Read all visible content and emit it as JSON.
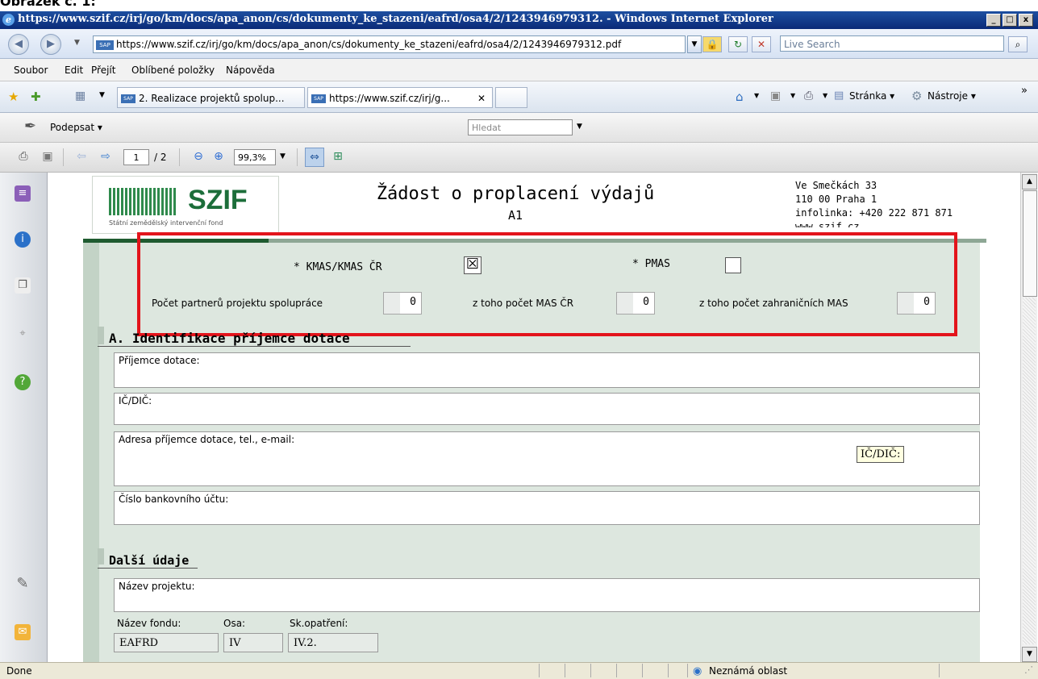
{
  "caption": "Obrázek č. 1:",
  "window": {
    "title": "https://www.szif.cz/irj/go/km/docs/apa_anon/cs/dokumenty_ke_stazeni/eafrd/osa4/2/1243946979312. - Windows Internet Explorer",
    "min": "_",
    "max": "□",
    "close": "x"
  },
  "address": {
    "url": "https://www.szif.cz/irj/go/km/docs/apa_anon/cs/dokumenty_ke_stazeni/eafrd/osa4/2/1243946979312.pdf",
    "search_placeholder": "Live Search"
  },
  "menu": [
    "Soubor",
    "Edit",
    "Přejít",
    "Oblíbené položky",
    "Nápověda"
  ],
  "tabs": [
    {
      "label": "2. Realizace projektů spolup..."
    },
    {
      "label": "https://www.szif.cz/irj/g..."
    }
  ],
  "commands": {
    "page": "Stránka",
    "tools": "Nástroje"
  },
  "pdf_toolbar1": {
    "sign": "Podepsat",
    "search_placeholder": "Hledat"
  },
  "pdf_toolbar2": {
    "page_current": "1",
    "page_total": "/ 2",
    "zoom": "99,3%"
  },
  "document": {
    "logo_text": "SZIF",
    "logo_sub": "Státní zemědělský intervenční fond",
    "title": "Žádost o proplacení výdajů",
    "subtitle": "A1",
    "address_lines": [
      "Ve Smečkách 33",
      "110 00 Praha 1",
      "infolinka: +420 222 871 871",
      "www.szif.cz"
    ],
    "kmas_label": "* KMAS/KMAS ČR",
    "kmas_checked": true,
    "pmas_label": "* PMAS",
    "pmas_checked": false,
    "partners_label": "Počet partnerů projektu spolupráce",
    "partners_value": "0",
    "mas_cr_label": "z toho počet MAS ČR",
    "mas_cr_value": "0",
    "mas_foreign_label": "z toho počet zahraničních MAS",
    "mas_foreign_value": "0",
    "section_a": "A. Identifikace příjemce dotace",
    "field_recipient": "Příjemce dotace:",
    "field_ico": "IČ/DIČ:",
    "field_address": "Adresa příjemce dotace, tel., e-mail:",
    "field_account": "Číslo bankovního účtu:",
    "tooltip": "IČ/DIČ:",
    "section_other": "Další údaje",
    "field_project": "Název projektu:",
    "fund_label": "Název fondu:",
    "fund_value": "EAFRD",
    "axis_label": "Osa:",
    "axis_value": "IV",
    "measure_label": "Sk.opatření:",
    "measure_value": "IV.2."
  },
  "status": {
    "left": "Done",
    "zone": "Neznámá oblast"
  }
}
